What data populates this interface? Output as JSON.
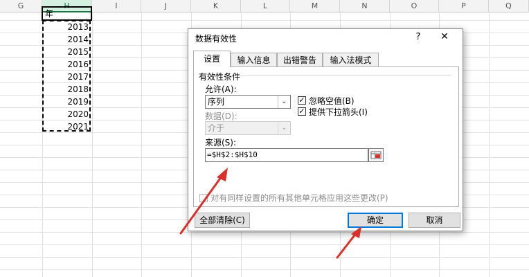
{
  "sheet": {
    "columns": [
      "G",
      "H",
      "I",
      "J",
      "K",
      "L",
      "M",
      "N",
      "O",
      "P",
      "Q"
    ],
    "header_cell": "年",
    "years": [
      "2013",
      "2014",
      "2015",
      "2016",
      "2017",
      "2018",
      "2019",
      "2020",
      "2021"
    ]
  },
  "dialog": {
    "title": "数据有效性",
    "help_glyph": "?",
    "close_glyph": "✕",
    "tabs": [
      "设置",
      "输入信息",
      "出错警告",
      "输入法模式"
    ],
    "group_label": "有效性条件",
    "allow_label": "允许(A):",
    "allow_value": "序列",
    "ignore_blank_label": "忽略空值(B)",
    "ignore_blank_checked": true,
    "dropdown_label": "提供下拉箭头(I)",
    "dropdown_checked": true,
    "data_label": "数据(D):",
    "data_value": "介于",
    "source_label": "来源(S):",
    "source_value": "=$H$2:$H$10",
    "apply_all_label": "对有同样设置的所有其他单元格应用这些更改(P)",
    "apply_all_checked": false,
    "clear_all_label": "全部清除(C)",
    "ok_label": "确定",
    "cancel_label": "取消",
    "check_glyph": "✓",
    "dropdown_glyph": "⌄"
  },
  "colors": {
    "accent_blue": "#0078d7",
    "annotation_red": "#d9302a",
    "excel_green": "#217346"
  }
}
